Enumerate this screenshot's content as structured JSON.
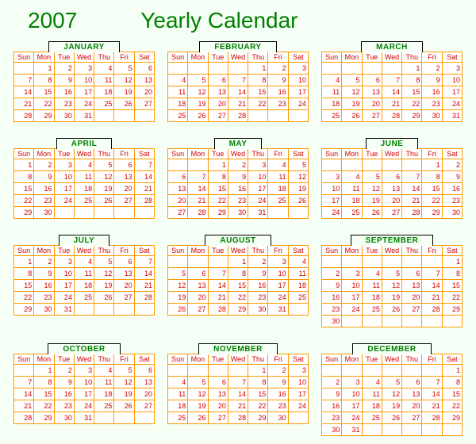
{
  "header": {
    "year": "2007",
    "title": "Yearly Calendar"
  },
  "dayHeaders": [
    "Sun",
    "Mon",
    "Tue",
    "Wed",
    "Thu",
    "Fri",
    "Sat"
  ],
  "months": [
    {
      "name": "JANUARY",
      "startDay": 1,
      "days": 31
    },
    {
      "name": "FEBRUARY",
      "startDay": 4,
      "days": 28
    },
    {
      "name": "MARCH",
      "startDay": 4,
      "days": 31
    },
    {
      "name": "APRIL",
      "startDay": 0,
      "days": 30
    },
    {
      "name": "MAY",
      "startDay": 2,
      "days": 31
    },
    {
      "name": "JUNE",
      "startDay": 5,
      "days": 30
    },
    {
      "name": "JULY",
      "startDay": 0,
      "days": 31
    },
    {
      "name": "AUGUST",
      "startDay": 3,
      "days": 31
    },
    {
      "name": "SEPTEMBER",
      "startDay": 6,
      "days": 30
    },
    {
      "name": "OCTOBER",
      "startDay": 1,
      "days": 31
    },
    {
      "name": "NOVEMBER",
      "startDay": 4,
      "days": 30
    },
    {
      "name": "DECEMBER",
      "startDay": 6,
      "days": 31
    }
  ]
}
